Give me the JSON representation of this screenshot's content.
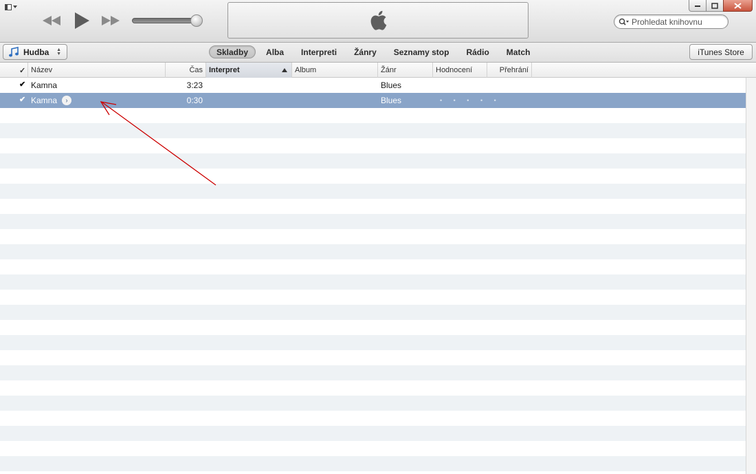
{
  "player": {
    "search_placeholder": "Prohledat knihovnu"
  },
  "nav": {
    "source_label": "Hudba",
    "tabs": [
      {
        "label": "Skladby",
        "active": true
      },
      {
        "label": "Alba",
        "active": false
      },
      {
        "label": "Interpreti",
        "active": false
      },
      {
        "label": "Žánry",
        "active": false
      },
      {
        "label": "Seznamy stop",
        "active": false
      },
      {
        "label": "Rádio",
        "active": false
      },
      {
        "label": "Match",
        "active": false
      }
    ],
    "store_label": "iTunes Store"
  },
  "columns": {
    "check": "✓",
    "name": "Název",
    "time": "Čas",
    "artist": "Interpret",
    "album": "Album",
    "genre": "Žánr",
    "rating": "Hodnocení",
    "plays": "Přehrání"
  },
  "tracks": [
    {
      "checked": true,
      "name": "Kamna",
      "time": "3:23",
      "artist": "",
      "album": "",
      "genre": "Blues",
      "rating": "",
      "plays": ""
    },
    {
      "checked": true,
      "name": "Kamna",
      "time": "0:30",
      "artist": "",
      "album": "",
      "genre": "Blues",
      "rating": "• • • • •",
      "plays": "",
      "selected": true
    }
  ],
  "colors": {
    "selection": "#89a4c8",
    "annotation_arrow": "#cc0000"
  }
}
